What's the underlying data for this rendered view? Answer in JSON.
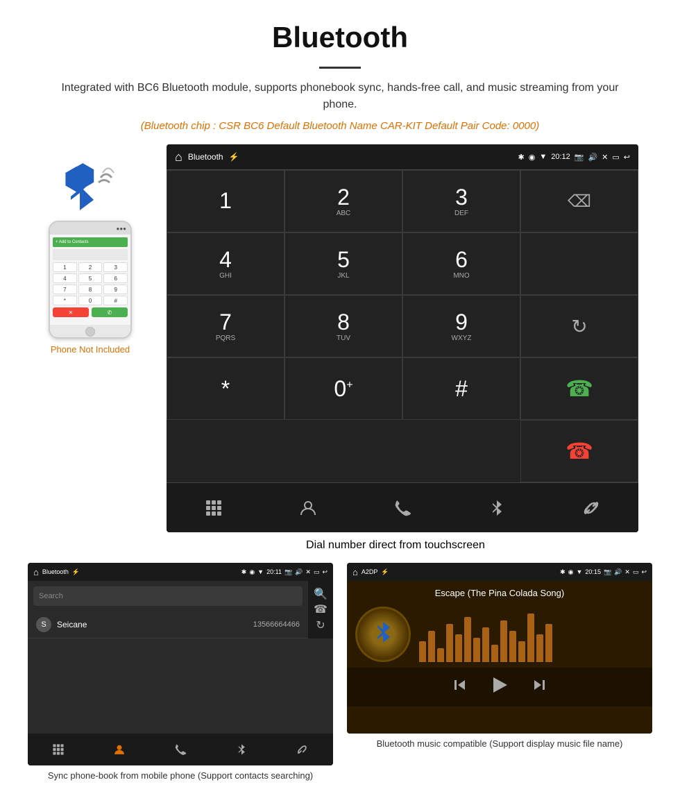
{
  "page": {
    "title": "Bluetooth",
    "subtitle": "Integrated with BC6 Bluetooth module, supports phonebook sync, hands-free call, and music streaming from your phone.",
    "orange_info": "(Bluetooth chip : CSR BC6    Default Bluetooth Name CAR-KIT    Default Pair Code: 0000)",
    "main_caption": "Dial number direct from touchscreen",
    "bottom_left_caption": "Sync phone-book from mobile phone\n(Support contacts searching)",
    "bottom_right_caption": "Bluetooth music compatible\n(Support display music file name)"
  },
  "phone": {
    "not_included": "Phone Not Included"
  },
  "dial_screen": {
    "title": "Bluetooth",
    "time": "20:12",
    "keys": [
      {
        "main": "1",
        "sub": ""
      },
      {
        "main": "2",
        "sub": "ABC"
      },
      {
        "main": "3",
        "sub": "DEF"
      },
      {
        "main": "⌫",
        "sub": ""
      },
      {
        "main": "4",
        "sub": "GHI"
      },
      {
        "main": "5",
        "sub": "JKL"
      },
      {
        "main": "6",
        "sub": "MNO"
      },
      {
        "main": "",
        "sub": ""
      },
      {
        "main": "7",
        "sub": "PQRS"
      },
      {
        "main": "8",
        "sub": "TUV"
      },
      {
        "main": "9",
        "sub": "WXYZ"
      },
      {
        "main": "↺",
        "sub": ""
      },
      {
        "main": "*",
        "sub": ""
      },
      {
        "main": "0",
        "sub": "+"
      },
      {
        "main": "#",
        "sub": ""
      },
      {
        "main": "✆",
        "sub": ""
      },
      {
        "main": "✆",
        "sub": "end"
      }
    ]
  },
  "phonebook_screen": {
    "title": "Bluetooth",
    "time": "20:11",
    "search_placeholder": "Search",
    "contact": {
      "letter": "S",
      "name": "Seicane",
      "number": "13566664466"
    }
  },
  "music_screen": {
    "title": "A2DP",
    "time": "20:15",
    "song_title": "Escape (The Pina Colada Song)",
    "viz_heights": [
      30,
      45,
      20,
      55,
      40,
      65,
      35,
      50,
      25,
      60,
      45,
      30,
      70,
      40,
      55
    ]
  },
  "nav": {
    "dial_items": [
      "⠿",
      "👤",
      "☎",
      "✱",
      "🔗"
    ],
    "phonebook_items": [
      "⠿",
      "👤",
      "☎",
      "✱",
      "🔗"
    ]
  }
}
